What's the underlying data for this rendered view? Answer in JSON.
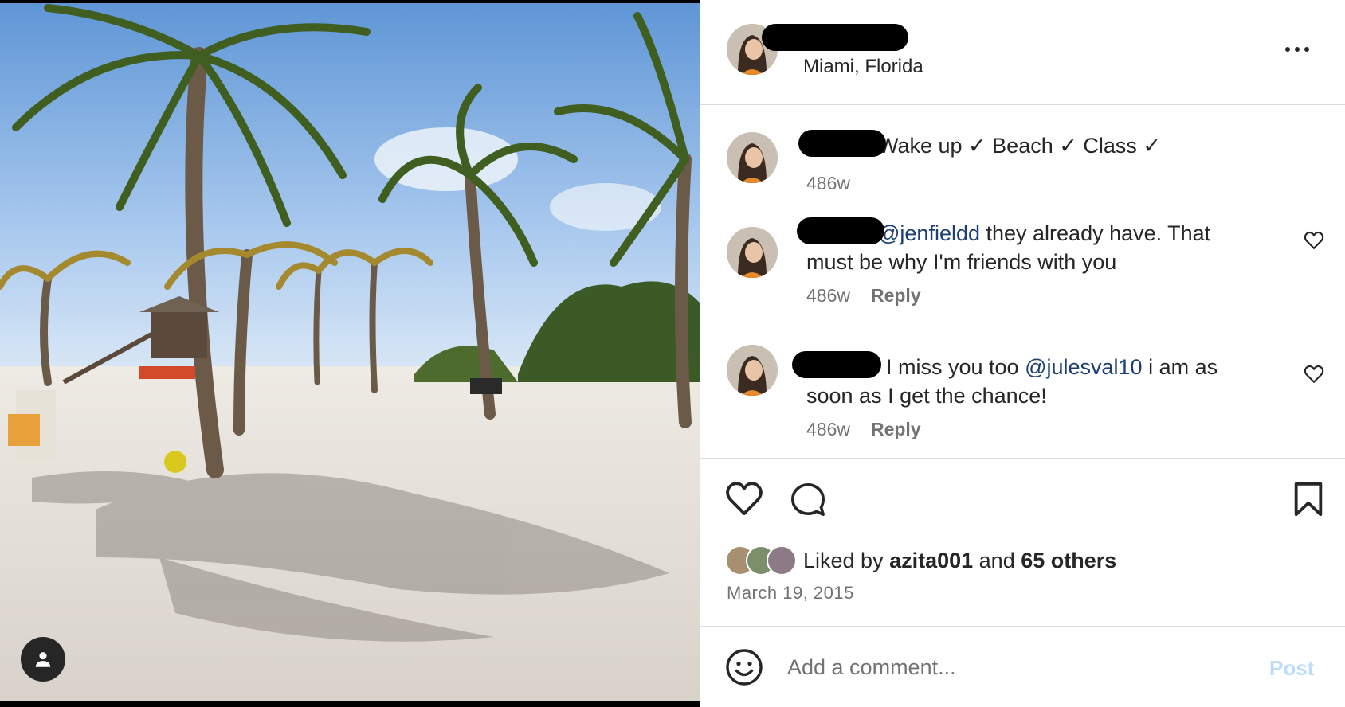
{
  "post": {
    "location": "Miami, Florida",
    "caption": {
      "text": "Wake up ✓ Beach ✓ Class ✓",
      "time": "486w"
    }
  },
  "comments": [
    {
      "mention": "@jenfieldd",
      "text_after": " they already have. That must be why I'm friends with you",
      "time": "486w",
      "reply": "Reply"
    },
    {
      "text_before": "I miss you too ",
      "mention": "@julesval10",
      "text_after": " i am as soon as I get the chance!",
      "time": "486w",
      "reply": "Reply"
    }
  ],
  "likes": {
    "prefix": "Liked by ",
    "user": "azita001",
    "and": " and ",
    "others": "65 others"
  },
  "date": "March 19, 2015",
  "add_comment": {
    "placeholder": "Add a comment...",
    "post_label": "Post"
  },
  "icons": {
    "more": "more-options-icon",
    "like": "heart-icon",
    "comment": "comment-bubble-icon",
    "save": "bookmark-icon",
    "emoji": "emoji-icon",
    "tag": "user-tag-icon"
  },
  "colors": {
    "mention": "#1c3f73",
    "post_disabled": "#bcdcfa",
    "muted": "#737373"
  }
}
